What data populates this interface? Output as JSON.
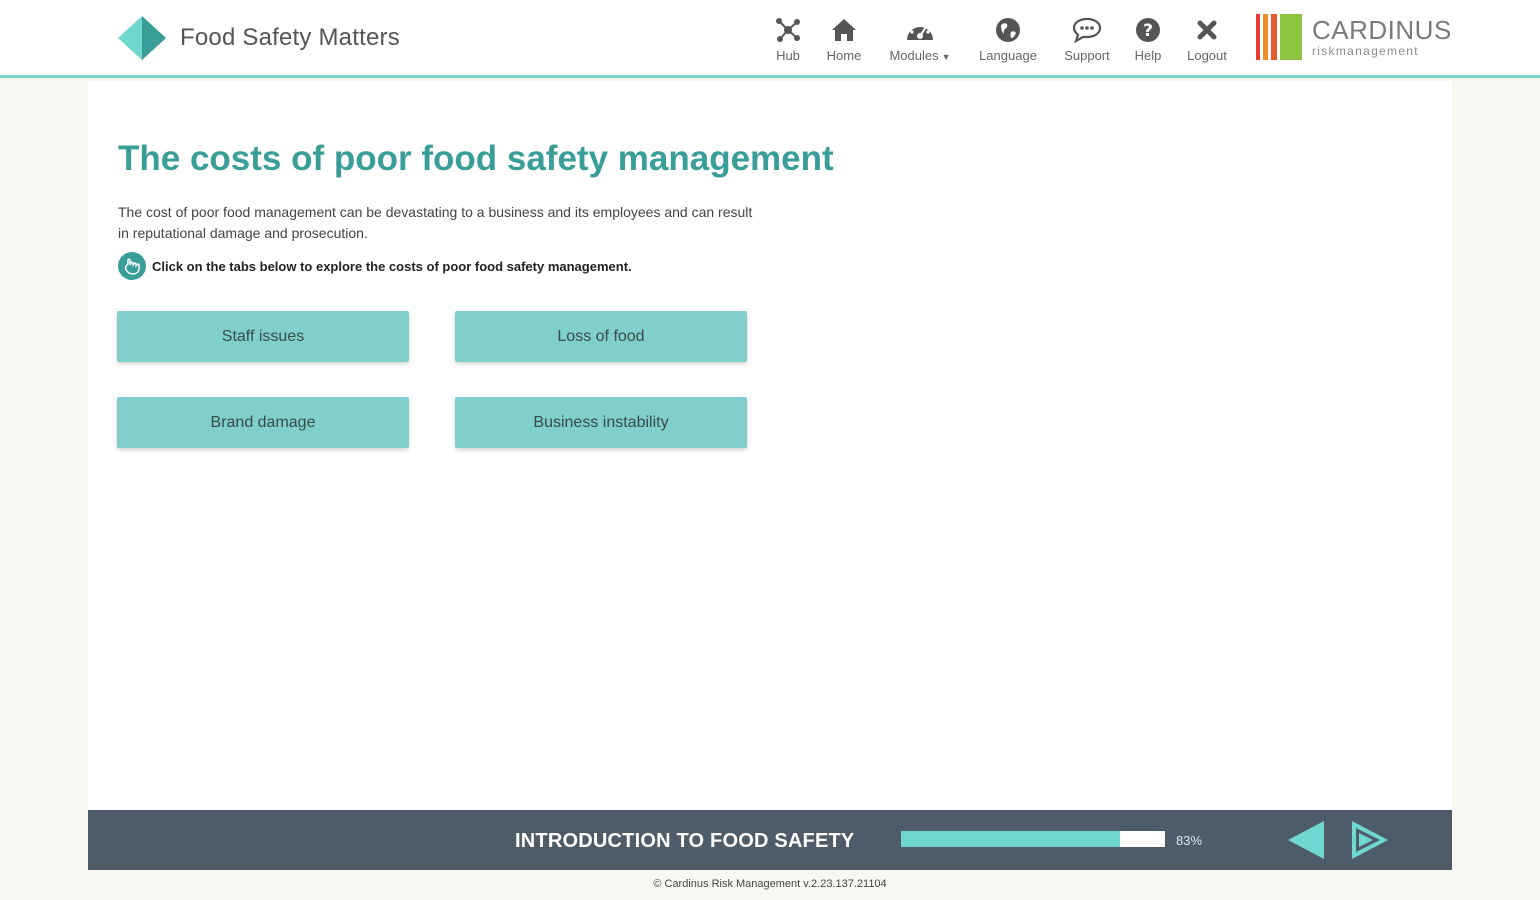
{
  "header": {
    "app_title": "Food Safety Matters",
    "nav": [
      {
        "label": "Hub",
        "icon": "hub-icon"
      },
      {
        "label": "Home",
        "icon": "home-icon"
      },
      {
        "label": "Modules",
        "icon": "dashboard-icon"
      },
      {
        "label": "Language",
        "icon": "globe-icon"
      },
      {
        "label": "Support",
        "icon": "chat-icon"
      },
      {
        "label": "Help",
        "icon": "help-icon"
      },
      {
        "label": "Logout",
        "icon": "close-icon"
      }
    ],
    "company": {
      "name": "CARDINUS",
      "tagline": "riskmanagement"
    }
  },
  "main": {
    "title": "The costs of poor food safety management",
    "intro": "The cost of poor food management can be devastating to a business and its employees and can result in reputational damage and prosecution.",
    "instruction": "Click on the tabs below to explore the costs of poor food safety management.",
    "tabs": [
      "Staff issues",
      "Loss of food",
      "Brand damage",
      "Business instability"
    ]
  },
  "footer": {
    "course_title": "INTRODUCTION TO FOOD SAFETY",
    "progress_percent": 83,
    "progress_label": "83%",
    "copyright": "Cardinus Risk Management v.2.23.137.21104"
  },
  "colors": {
    "accent": "#3a9e98",
    "accent_light": "#6fd6d0",
    "tab_bg": "#7fcfca",
    "footer_bg": "#4d5c68",
    "cardinus_bars": [
      "#e63b2e",
      "#f28c28",
      "#e85a2a",
      "#8cc63f"
    ]
  }
}
